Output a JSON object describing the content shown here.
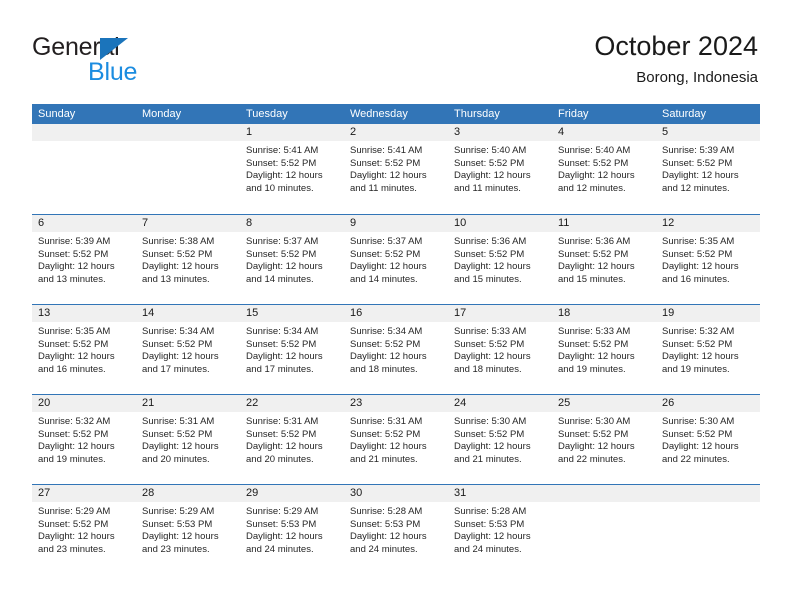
{
  "brand": {
    "name_top": "General",
    "name_bottom": "Blue",
    "accent_color": "#1b74bb",
    "accent_color_light": "#1b8ce0"
  },
  "header": {
    "title": "October 2024",
    "subtitle": "Borong, Indonesia"
  },
  "theme": {
    "header_row_bg": "#3275b7",
    "day_number_bg": "#f0f0f0",
    "grid_line": "#3275b7",
    "text": "#1a1a1a"
  },
  "calendar": {
    "day_names": [
      "Sunday",
      "Monday",
      "Tuesday",
      "Wednesday",
      "Thursday",
      "Friday",
      "Saturday"
    ],
    "weeks": [
      [
        {
          "day": "",
          "sunrise": "",
          "sunset": "",
          "daylight": "",
          "empty": true
        },
        {
          "day": "",
          "sunrise": "",
          "sunset": "",
          "daylight": "",
          "empty": true
        },
        {
          "day": "1",
          "sunrise": "Sunrise: 5:41 AM",
          "sunset": "Sunset: 5:52 PM",
          "daylight": "Daylight: 12 hours and 10 minutes."
        },
        {
          "day": "2",
          "sunrise": "Sunrise: 5:41 AM",
          "sunset": "Sunset: 5:52 PM",
          "daylight": "Daylight: 12 hours and 11 minutes."
        },
        {
          "day": "3",
          "sunrise": "Sunrise: 5:40 AM",
          "sunset": "Sunset: 5:52 PM",
          "daylight": "Daylight: 12 hours and 11 minutes."
        },
        {
          "day": "4",
          "sunrise": "Sunrise: 5:40 AM",
          "sunset": "Sunset: 5:52 PM",
          "daylight": "Daylight: 12 hours and 12 minutes."
        },
        {
          "day": "5",
          "sunrise": "Sunrise: 5:39 AM",
          "sunset": "Sunset: 5:52 PM",
          "daylight": "Daylight: 12 hours and 12 minutes."
        }
      ],
      [
        {
          "day": "6",
          "sunrise": "Sunrise: 5:39 AM",
          "sunset": "Sunset: 5:52 PM",
          "daylight": "Daylight: 12 hours and 13 minutes."
        },
        {
          "day": "7",
          "sunrise": "Sunrise: 5:38 AM",
          "sunset": "Sunset: 5:52 PM",
          "daylight": "Daylight: 12 hours and 13 minutes."
        },
        {
          "day": "8",
          "sunrise": "Sunrise: 5:37 AM",
          "sunset": "Sunset: 5:52 PM",
          "daylight": "Daylight: 12 hours and 14 minutes."
        },
        {
          "day": "9",
          "sunrise": "Sunrise: 5:37 AM",
          "sunset": "Sunset: 5:52 PM",
          "daylight": "Daylight: 12 hours and 14 minutes."
        },
        {
          "day": "10",
          "sunrise": "Sunrise: 5:36 AM",
          "sunset": "Sunset: 5:52 PM",
          "daylight": "Daylight: 12 hours and 15 minutes."
        },
        {
          "day": "11",
          "sunrise": "Sunrise: 5:36 AM",
          "sunset": "Sunset: 5:52 PM",
          "daylight": "Daylight: 12 hours and 15 minutes."
        },
        {
          "day": "12",
          "sunrise": "Sunrise: 5:35 AM",
          "sunset": "Sunset: 5:52 PM",
          "daylight": "Daylight: 12 hours and 16 minutes."
        }
      ],
      [
        {
          "day": "13",
          "sunrise": "Sunrise: 5:35 AM",
          "sunset": "Sunset: 5:52 PM",
          "daylight": "Daylight: 12 hours and 16 minutes."
        },
        {
          "day": "14",
          "sunrise": "Sunrise: 5:34 AM",
          "sunset": "Sunset: 5:52 PM",
          "daylight": "Daylight: 12 hours and 17 minutes."
        },
        {
          "day": "15",
          "sunrise": "Sunrise: 5:34 AM",
          "sunset": "Sunset: 5:52 PM",
          "daylight": "Daylight: 12 hours and 17 minutes."
        },
        {
          "day": "16",
          "sunrise": "Sunrise: 5:34 AM",
          "sunset": "Sunset: 5:52 PM",
          "daylight": "Daylight: 12 hours and 18 minutes."
        },
        {
          "day": "17",
          "sunrise": "Sunrise: 5:33 AM",
          "sunset": "Sunset: 5:52 PM",
          "daylight": "Daylight: 12 hours and 18 minutes."
        },
        {
          "day": "18",
          "sunrise": "Sunrise: 5:33 AM",
          "sunset": "Sunset: 5:52 PM",
          "daylight": "Daylight: 12 hours and 19 minutes."
        },
        {
          "day": "19",
          "sunrise": "Sunrise: 5:32 AM",
          "sunset": "Sunset: 5:52 PM",
          "daylight": "Daylight: 12 hours and 19 minutes."
        }
      ],
      [
        {
          "day": "20",
          "sunrise": "Sunrise: 5:32 AM",
          "sunset": "Sunset: 5:52 PM",
          "daylight": "Daylight: 12 hours and 19 minutes."
        },
        {
          "day": "21",
          "sunrise": "Sunrise: 5:31 AM",
          "sunset": "Sunset: 5:52 PM",
          "daylight": "Daylight: 12 hours and 20 minutes."
        },
        {
          "day": "22",
          "sunrise": "Sunrise: 5:31 AM",
          "sunset": "Sunset: 5:52 PM",
          "daylight": "Daylight: 12 hours and 20 minutes."
        },
        {
          "day": "23",
          "sunrise": "Sunrise: 5:31 AM",
          "sunset": "Sunset: 5:52 PM",
          "daylight": "Daylight: 12 hours and 21 minutes."
        },
        {
          "day": "24",
          "sunrise": "Sunrise: 5:30 AM",
          "sunset": "Sunset: 5:52 PM",
          "daylight": "Daylight: 12 hours and 21 minutes."
        },
        {
          "day": "25",
          "sunrise": "Sunrise: 5:30 AM",
          "sunset": "Sunset: 5:52 PM",
          "daylight": "Daylight: 12 hours and 22 minutes."
        },
        {
          "day": "26",
          "sunrise": "Sunrise: 5:30 AM",
          "sunset": "Sunset: 5:52 PM",
          "daylight": "Daylight: 12 hours and 22 minutes."
        }
      ],
      [
        {
          "day": "27",
          "sunrise": "Sunrise: 5:29 AM",
          "sunset": "Sunset: 5:52 PM",
          "daylight": "Daylight: 12 hours and 23 minutes."
        },
        {
          "day": "28",
          "sunrise": "Sunrise: 5:29 AM",
          "sunset": "Sunset: 5:53 PM",
          "daylight": "Daylight: 12 hours and 23 minutes."
        },
        {
          "day": "29",
          "sunrise": "Sunrise: 5:29 AM",
          "sunset": "Sunset: 5:53 PM",
          "daylight": "Daylight: 12 hours and 24 minutes."
        },
        {
          "day": "30",
          "sunrise": "Sunrise: 5:28 AM",
          "sunset": "Sunset: 5:53 PM",
          "daylight": "Daylight: 12 hours and 24 minutes."
        },
        {
          "day": "31",
          "sunrise": "Sunrise: 5:28 AM",
          "sunset": "Sunset: 5:53 PM",
          "daylight": "Daylight: 12 hours and 24 minutes."
        },
        {
          "day": "",
          "sunrise": "",
          "sunset": "",
          "daylight": "",
          "empty": true
        },
        {
          "day": "",
          "sunrise": "",
          "sunset": "",
          "daylight": "",
          "empty": true
        }
      ]
    ]
  }
}
